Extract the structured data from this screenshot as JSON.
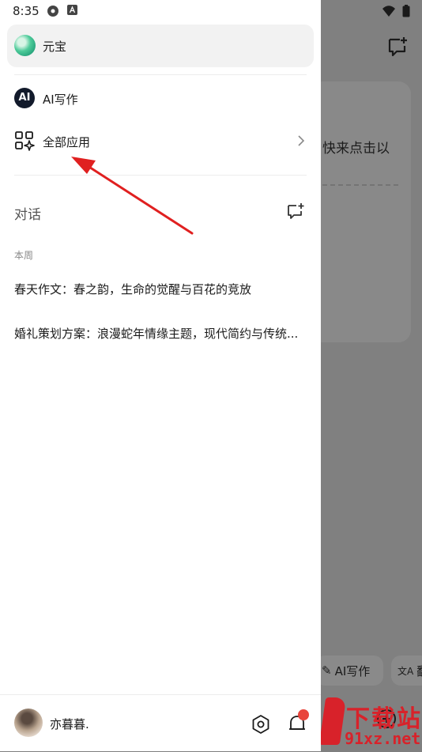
{
  "status_bar": {
    "time": "8:35"
  },
  "drawer": {
    "yuanbao_label": "元宝",
    "ai_writing_icon_text": "AI",
    "ai_writing_label": "AI写作",
    "all_apps_label": "全部应用",
    "conversations_title": "对话",
    "week_label": "本周",
    "history": [
      "春天作文：春之韵，生命的觉醒与百花的竞放",
      "婚礼策划方案：浪漫蛇年情缘主题，现代简约与传统..."
    ],
    "user_name": "亦暮暮."
  },
  "background": {
    "card_text": "快来点击以",
    "chip_ai_writing": "AI写作",
    "chip_translate": "翻"
  },
  "watermark": {
    "top_text": "下载站",
    "bottom_text": "91xz.net"
  },
  "colors": {
    "accent_red": "#e02020",
    "drawer_bg": "#ffffff",
    "overlay": "#808080"
  }
}
